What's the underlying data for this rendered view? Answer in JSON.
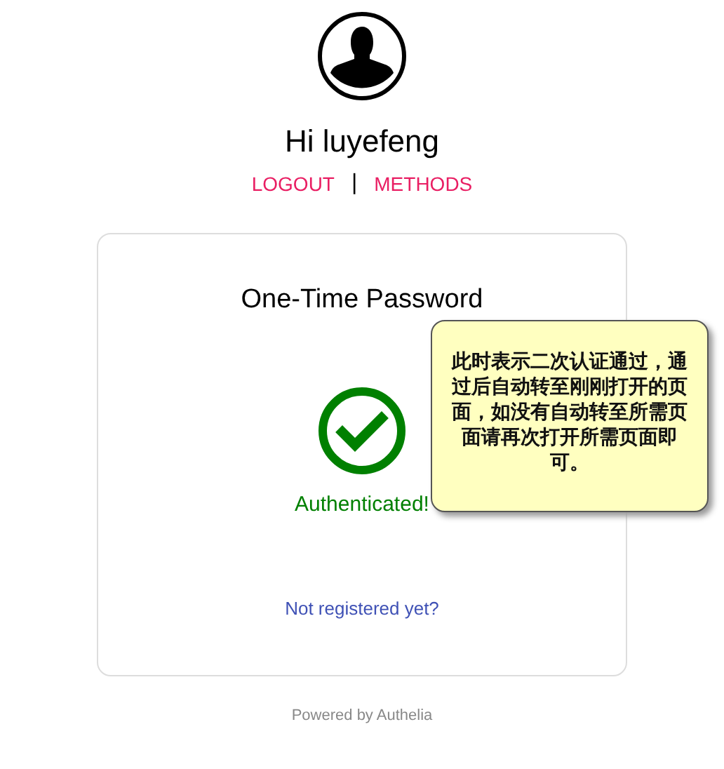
{
  "greeting": "Hi luyefeng",
  "nav_links": [
    {
      "label": "LOGOUT"
    },
    {
      "label": "METHODS"
    }
  ],
  "nav_separator": "|",
  "card": {
    "title": "One-Time Password",
    "status": "Authenticated!",
    "success": true,
    "link": "Not registered yet?"
  },
  "callout": {
    "text": "此时表示二次认证通过，通过后自动转至刚刚打开的页面，如没有自动转至所需页面请再次打开所需页面即可。"
  },
  "footer": "Powered by Authelia"
}
